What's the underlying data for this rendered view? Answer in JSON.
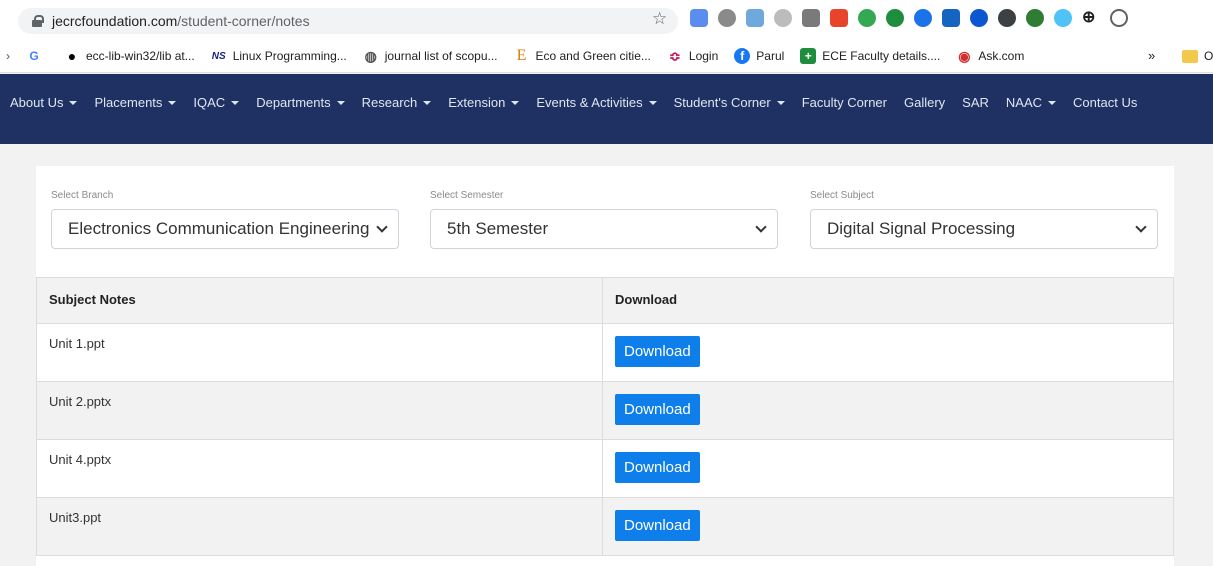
{
  "browser": {
    "url_host": "jecrcfoundation.com",
    "url_path": "/student-corner/notes",
    "bookmarks": [
      {
        "label": "",
        "icon": "G",
        "color": "#4285f4"
      },
      {
        "label": "ecc-lib-win32/lib at...",
        "icon": "github-icon",
        "color": "#000000"
      },
      {
        "label": "Linux Programming...",
        "icon": "NS",
        "color": "#1a237e"
      },
      {
        "label": "journal list of scopu...",
        "icon": "globe-icon",
        "color": "#555555"
      },
      {
        "label": "Eco and Green citie...",
        "icon": "E",
        "color": "#e07b00"
      },
      {
        "label": "Login",
        "icon": "chevron-icon",
        "color": "#c2185b"
      },
      {
        "label": "Parul",
        "icon": "facebook-icon",
        "color": "#1877f2"
      },
      {
        "label": "ECE Faculty details....",
        "icon": "plus-icon",
        "color": "#1e8e3e"
      },
      {
        "label": "Ask.com",
        "icon": "ask-icon",
        "color": "#d32f2f"
      }
    ],
    "more_label": "»",
    "folder_label": "O"
  },
  "nav": {
    "items": [
      {
        "label": "About Us",
        "dropdown": true
      },
      {
        "label": "Placements",
        "dropdown": true
      },
      {
        "label": "IQAC",
        "dropdown": true
      },
      {
        "label": "Departments",
        "dropdown": true
      },
      {
        "label": "Research",
        "dropdown": true
      },
      {
        "label": "Extension",
        "dropdown": true
      },
      {
        "label": "Events & Activities",
        "dropdown": true
      },
      {
        "label": "Student's Corner",
        "dropdown": true
      },
      {
        "label": "Faculty Corner",
        "dropdown": false
      },
      {
        "label": "Gallery",
        "dropdown": false
      },
      {
        "label": "SAR",
        "dropdown": false
      },
      {
        "label": "NAAC",
        "dropdown": true
      },
      {
        "label": "Contact Us",
        "dropdown": false
      }
    ]
  },
  "filters": {
    "branch": {
      "label": "Select Branch",
      "value": "Electronics Communication Engineering"
    },
    "semester": {
      "label": "Select Semester",
      "value": "5th Semester"
    },
    "subject": {
      "label": "Select Subject",
      "value": "Digital Signal Processing"
    }
  },
  "table": {
    "headers": [
      "Subject Notes",
      "Download"
    ],
    "rows": [
      {
        "file": "Unit 1.ppt",
        "action": "Download"
      },
      {
        "file": "Unit 2.pptx",
        "action": "Download"
      },
      {
        "file": "Unit 4.pptx",
        "action": "Download"
      },
      {
        "file": "Unit3.ppt",
        "action": "Download"
      }
    ]
  },
  "colors": {
    "nav_bg": "#1e3162",
    "button_bg": "#0d7eea"
  }
}
